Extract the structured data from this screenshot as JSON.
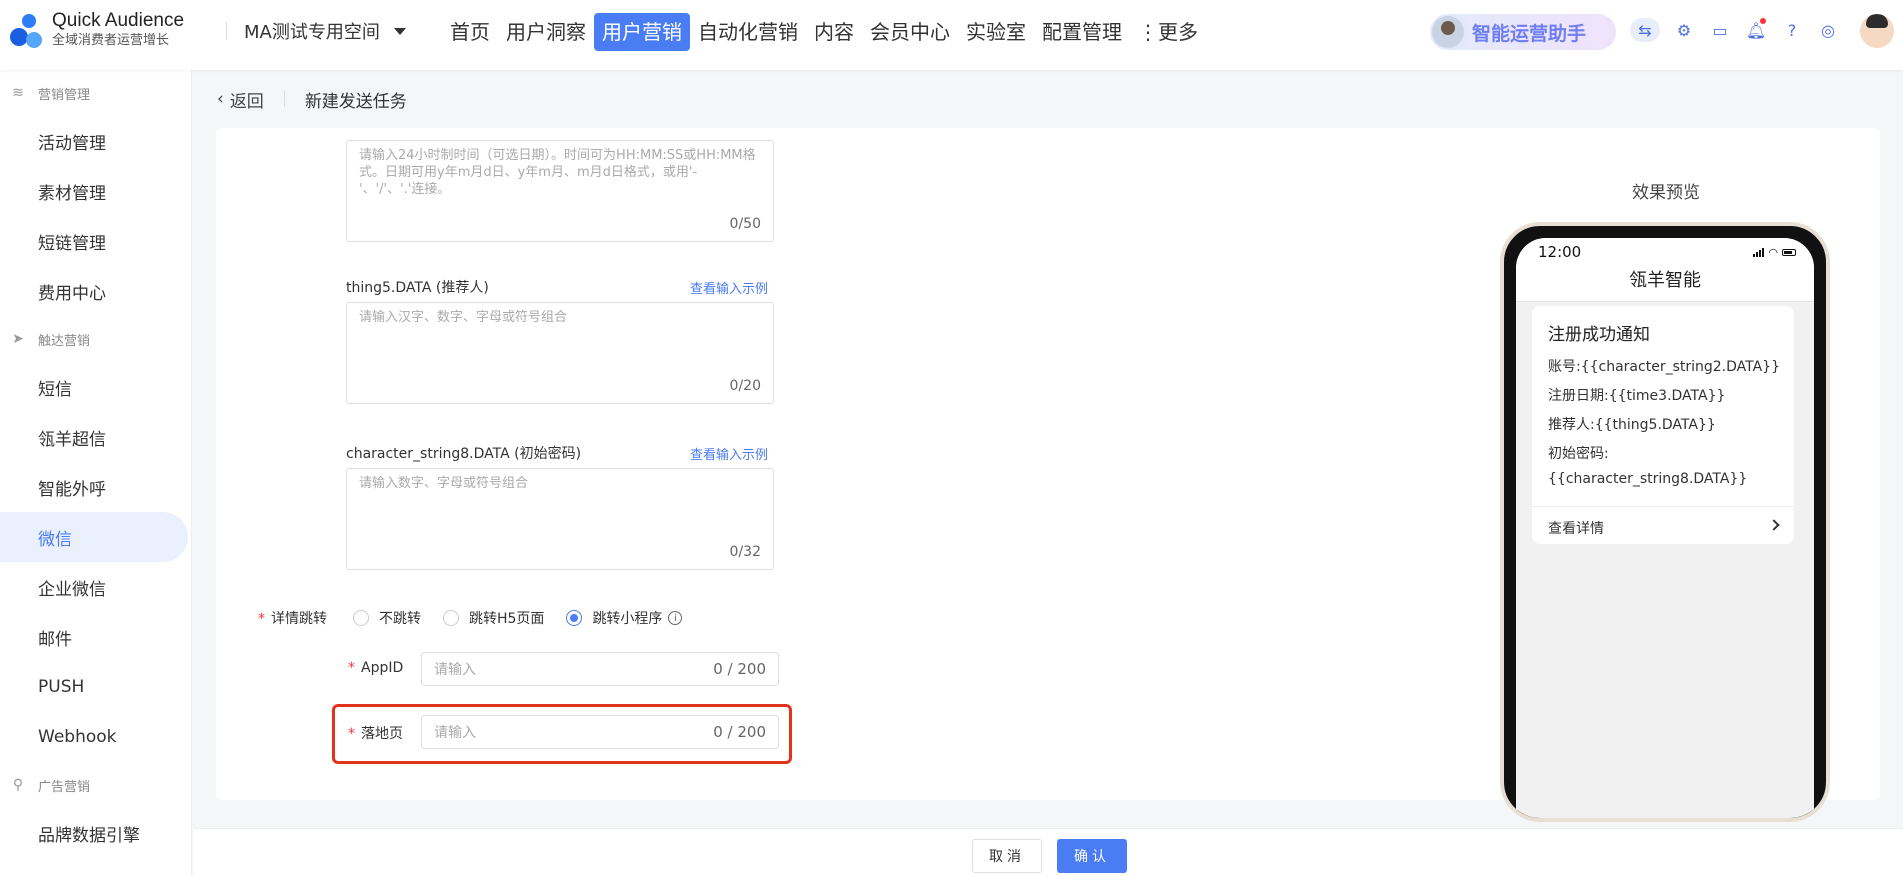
{
  "app": {
    "logo_title": "Quick Audience",
    "logo_subtitle": "全域消费者运营增长",
    "workspace": "MA测试专用空间"
  },
  "nav": {
    "items": [
      "首页",
      "用户洞察",
      "用户营销",
      "自动化营销",
      "内容",
      "会员中心",
      "实验室",
      "配置管理",
      "⋮更多"
    ],
    "active": "用户营销"
  },
  "assistant": {
    "label": "智能运营助手"
  },
  "sidebar": {
    "group_marketing": "营销管理",
    "marketing_items": [
      "活动管理",
      "素材管理",
      "短链管理",
      "费用中心"
    ],
    "group_reach": "触达营销",
    "reach_items": [
      "短信",
      "瓴羊超信",
      "智能外呼",
      "微信",
      "企业微信",
      "邮件",
      "PUSH",
      "Webhook"
    ],
    "group_ads": "广告营销",
    "ads_items": [
      "品牌数据引擎"
    ]
  },
  "breadcrumb": {
    "back": "返回",
    "title": "新建发送任务"
  },
  "form": {
    "time_placeholder": "请输入24小时制时间（可选日期）。时间可为HH:MM:SS或HH:MM格式。日期可用y年m月d日、y年m月、m月d日格式，或用'-'、'/'、'.'连接。",
    "time_counter": "0/50",
    "thing5_label": "thing5.DATA (推荐人)",
    "thing5_link": "查看输入示例",
    "thing5_placeholder": "请输入汉字、数字、字母或符号组合",
    "thing5_counter": "0/20",
    "cs8_label": "character_string8.DATA (初始密码)",
    "cs8_link": "查看输入示例",
    "cs8_placeholder": "请输入数字、字母或符号组合",
    "cs8_counter": "0/32",
    "jump_label": "详情跳转",
    "jump_options": [
      "不跳转",
      "跳转H5页面",
      "跳转小程序"
    ],
    "jump_selected": "跳转小程序",
    "appid_label": "AppID",
    "appid_placeholder": "请输入",
    "appid_counter": "0 / 200",
    "landing_label": "落地页",
    "landing_placeholder": "请输入",
    "landing_counter": "0 / 200"
  },
  "preview": {
    "title": "效果预览",
    "time": "12:00",
    "app_name": "瓴羊智能",
    "msg_title": "注册成功通知",
    "lines": [
      "账号:{{character_string2.DATA}}",
      "注册日期:{{time3.DATA}}",
      "推荐人:{{thing5.DATA}}",
      "初始密码:",
      "{{character_string8.DATA}}"
    ],
    "more": "查看详情"
  },
  "footer": {
    "cancel": "取消",
    "ok": "确认"
  },
  "colors": {
    "primary": "#4a7cf3",
    "highlight": "#e0341f"
  }
}
